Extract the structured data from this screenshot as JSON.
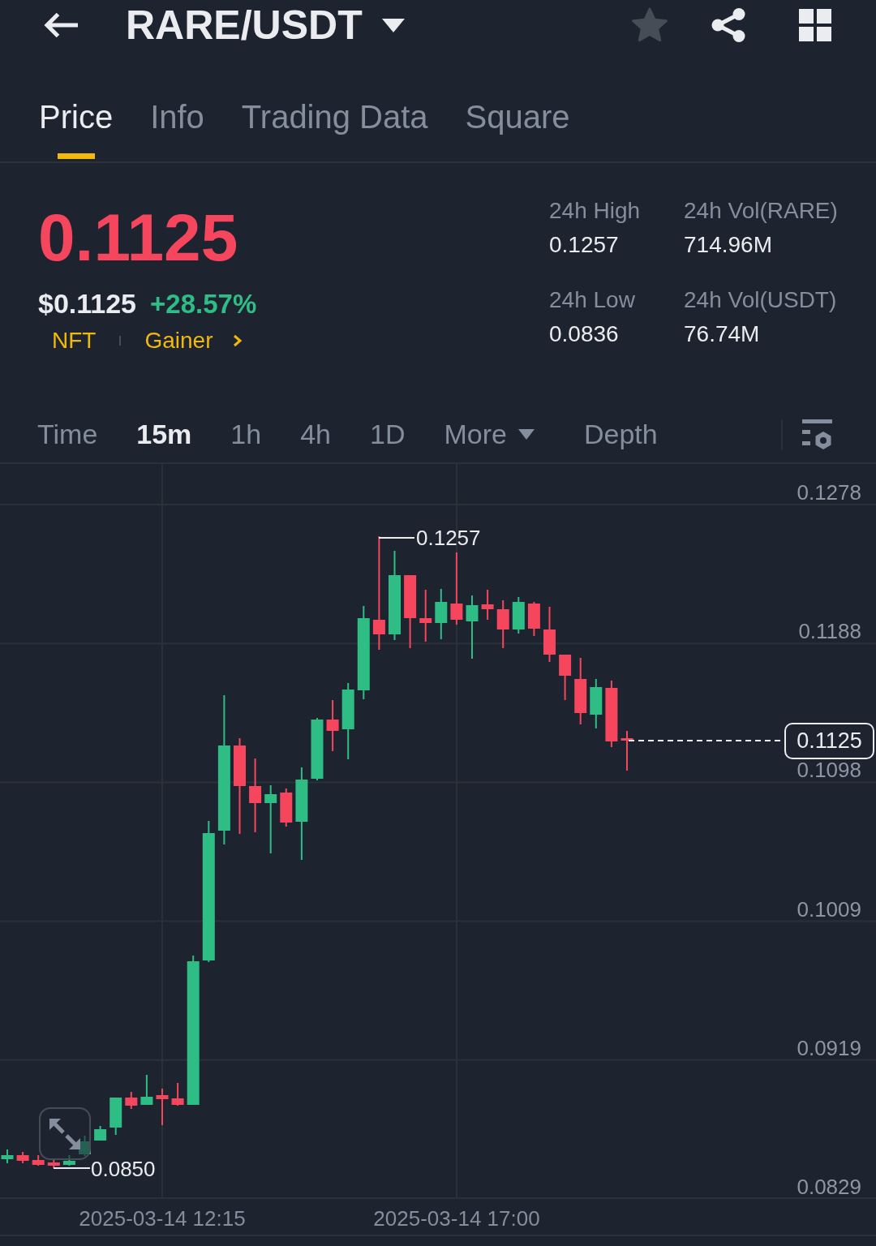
{
  "header": {
    "title": "RARE/USDT",
    "favorited": false
  },
  "tabs": [
    {
      "label": "Price",
      "selected": true
    },
    {
      "label": "Info",
      "selected": false
    },
    {
      "label": "Trading Data",
      "selected": false
    },
    {
      "label": "Square",
      "selected": false
    }
  ],
  "ticker": {
    "last_price": "0.1125",
    "last_price_rising": false,
    "usd_price": "$0.1125",
    "change": "+28.57%",
    "change_rising": true,
    "tags": [
      "NFT",
      "Gainer"
    ]
  },
  "stats": [
    {
      "label": "24h High",
      "value": "0.1257"
    },
    {
      "label": "24h Vol(RARE)",
      "value": "714.96M"
    },
    {
      "label": "24h Low",
      "value": "0.0836"
    },
    {
      "label": "24h Vol(USDT)",
      "value": "76.74M"
    }
  ],
  "intervals": [
    {
      "label": "Time",
      "kind": "option",
      "selected": false
    },
    {
      "label": "15m",
      "kind": "option",
      "selected": true
    },
    {
      "label": "1h",
      "kind": "option",
      "selected": false
    },
    {
      "label": "4h",
      "kind": "option",
      "selected": false
    },
    {
      "label": "1D",
      "kind": "option",
      "selected": false
    },
    {
      "label": "More",
      "kind": "dropdown",
      "selected": false
    },
    {
      "label": "Depth",
      "kind": "view",
      "selected": false
    }
  ],
  "chart": {
    "y_axis_labels": [
      "0.1278",
      "0.1188",
      "0.1098",
      "0.1009",
      "0.0919",
      "0.0829"
    ],
    "x_axis_labels": [
      "2025-03-14 12:15",
      "2025-03-14 17:00"
    ],
    "high_label": "0.1257",
    "low_label": "0.0850",
    "last_price_label": "0.1125"
  }
}
